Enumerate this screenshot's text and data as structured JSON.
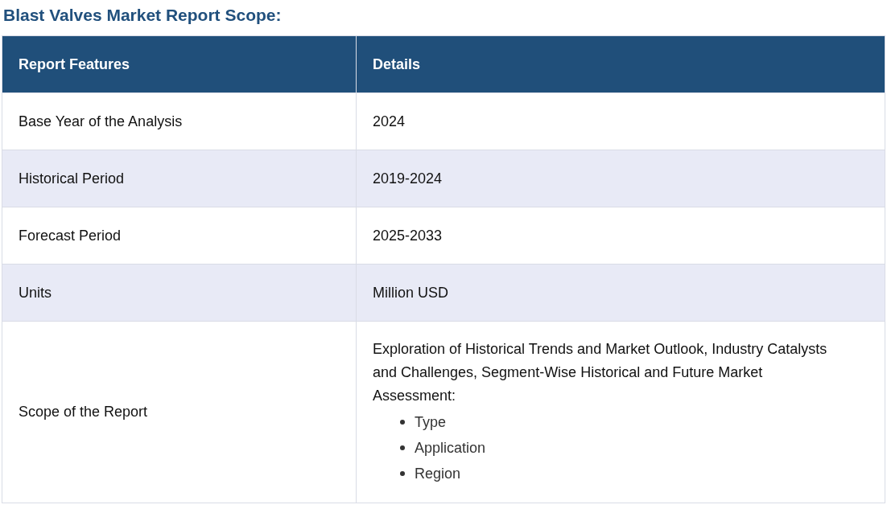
{
  "title": "Blast Valves Market Report Scope:",
  "table": {
    "columns": [
      "Report Features",
      "Details"
    ],
    "rows": [
      {
        "feature": "Base Year of the Analysis",
        "details": "2024"
      },
      {
        "feature": "Historical Period",
        "details": "2019-2024"
      },
      {
        "feature": "Forecast Period",
        "details": "2025-2033"
      },
      {
        "feature": "Units",
        "details": "Million USD"
      },
      {
        "feature": "Scope of the Report",
        "details": "Exploration of Historical Trends and Market Outlook, Industry Catalysts and Challenges, Segment-Wise Historical and Future Market Assessment:",
        "list": [
          "Type",
          "Application",
          "Region"
        ]
      }
    ]
  }
}
